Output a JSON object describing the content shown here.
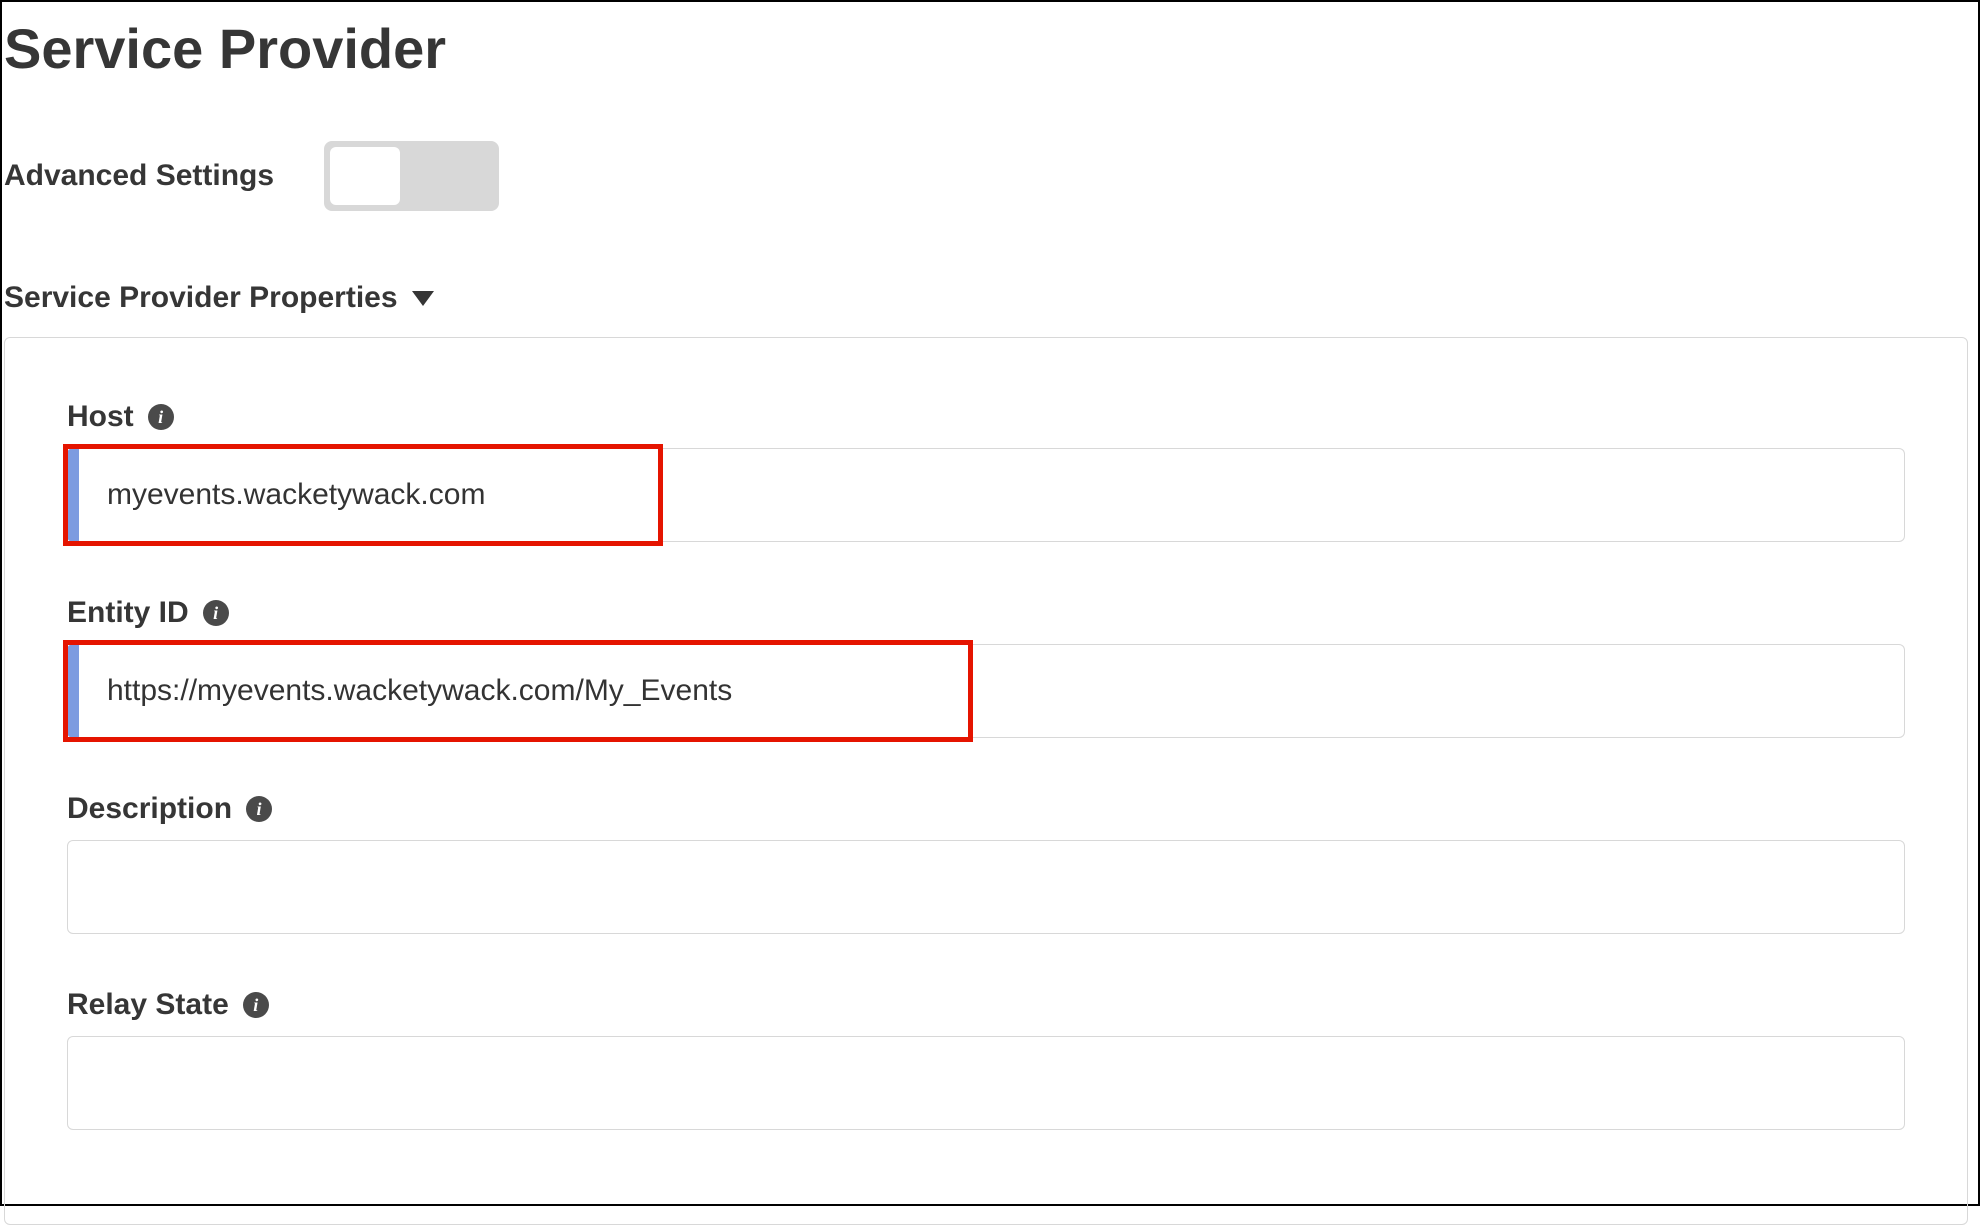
{
  "header": {
    "page_title": "Service Provider",
    "advanced_settings_label": "Advanced Settings",
    "advanced_settings_enabled": false
  },
  "section": {
    "title": "Service Provider Properties"
  },
  "fields": {
    "host": {
      "label": "Host",
      "value": "myevents.wacketywack.com"
    },
    "entity_id": {
      "label": "Entity ID",
      "value": "https://myevents.wacketywack.com/My_Events"
    },
    "description": {
      "label": "Description",
      "value": ""
    },
    "relay_state": {
      "label": "Relay State",
      "value": ""
    }
  }
}
